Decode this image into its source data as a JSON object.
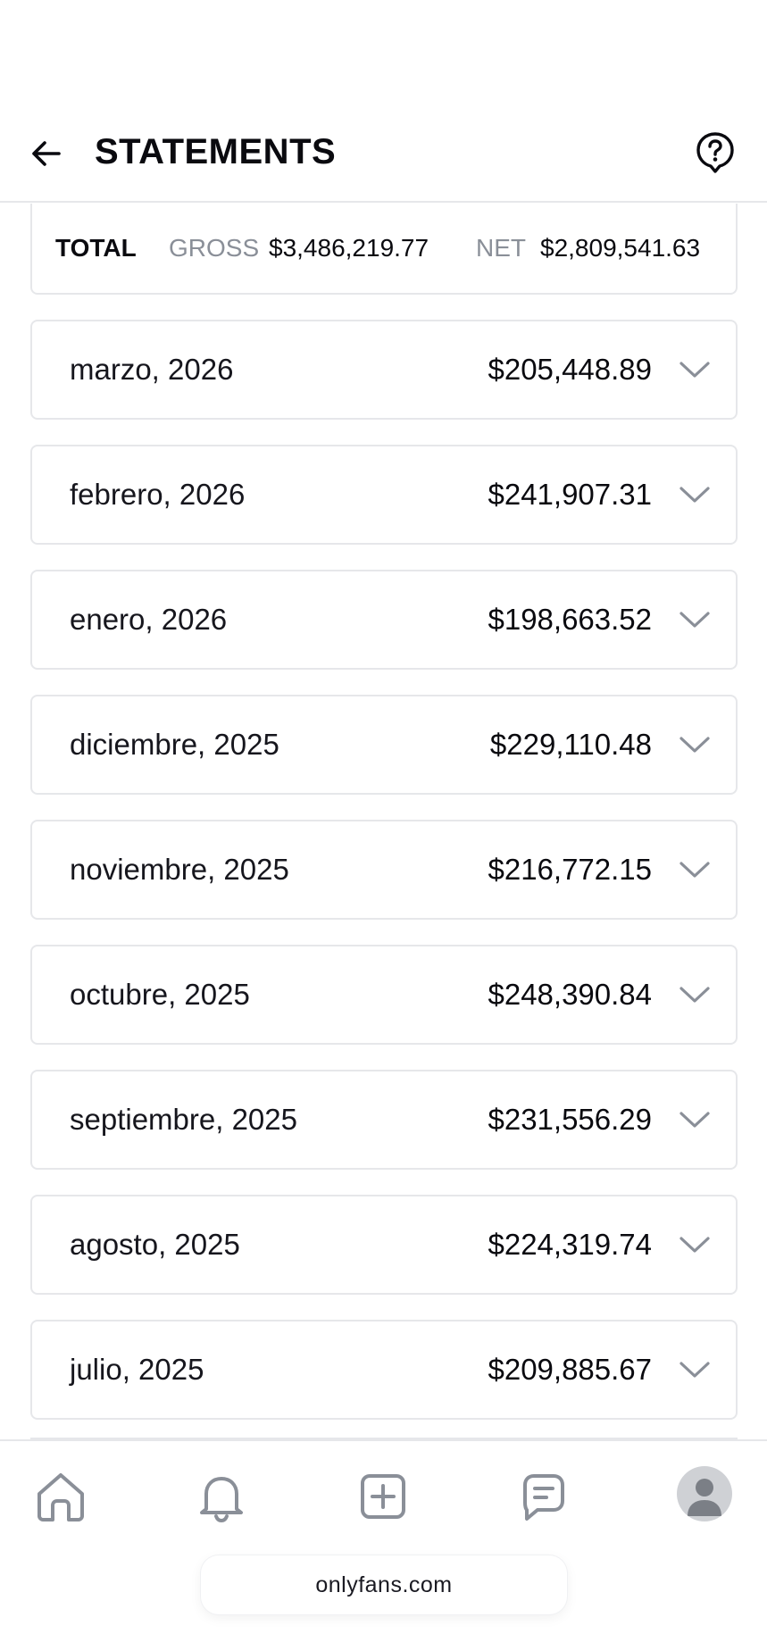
{
  "header": {
    "title": "STATEMENTS",
    "back_icon": "arrow-left-icon",
    "help_icon": "question-circle-icon"
  },
  "totals": {
    "total_label": "TOTAL",
    "gross_label": "GROSS",
    "gross_value": "$3,486,219.77",
    "net_label": "NET",
    "net_value": "$2,809,541.63"
  },
  "statements": [
    {
      "month": "marzo, 2026",
      "amount": "$205,448.89"
    },
    {
      "month": "febrero, 2026",
      "amount": "$241,907.31"
    },
    {
      "month": "enero, 2026",
      "amount": "$198,663.52"
    },
    {
      "month": "diciembre, 2025",
      "amount": "$229,110.48"
    },
    {
      "month": "noviembre, 2025",
      "amount": "$216,772.15"
    },
    {
      "month": "octubre, 2025",
      "amount": "$248,390.84"
    },
    {
      "month": "septiembre, 2025",
      "amount": "$231,556.29"
    },
    {
      "month": "agosto, 2025",
      "amount": "$224,319.74"
    },
    {
      "month": "julio, 2025",
      "amount": "$209,885.67"
    }
  ],
  "bottom_nav": {
    "items": [
      "home-icon",
      "bell-icon",
      "plus-square-icon",
      "message-icon",
      "avatar"
    ]
  },
  "url_bar": {
    "url": "onlyfans.com"
  },
  "colors": {
    "border": "#e6e7ea",
    "muted_text": "#8a8f98",
    "icon_gray": "#8a8f98",
    "text": "#0a0a0f"
  }
}
